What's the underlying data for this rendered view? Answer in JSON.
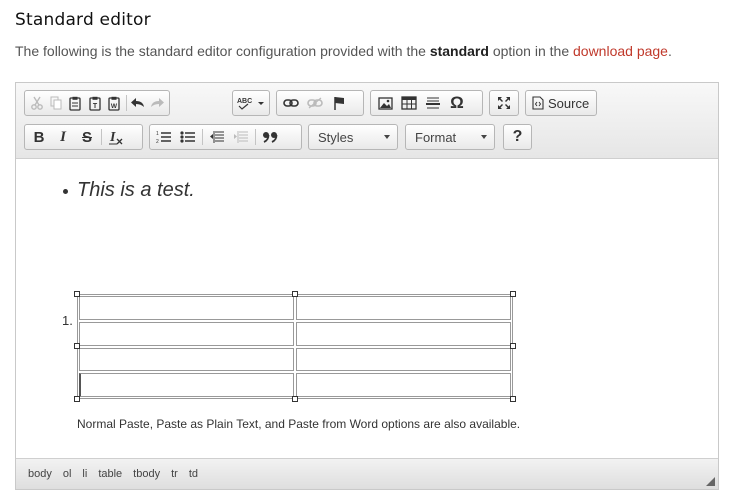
{
  "header": {
    "title": "Standard editor",
    "intro_prefix": "The following is the standard editor configuration provided with the ",
    "intro_bold": "standard",
    "intro_mid": " option in the ",
    "intro_link": "download page",
    "intro_end": "."
  },
  "toolbar": {
    "source_label": "Source",
    "styles_label": "Styles",
    "format_label": "Format",
    "help_label": "?",
    "spell_label": "ABC",
    "special_char": "Ω",
    "bold_glyph": "B",
    "italic_glyph": "I",
    "strike_glyph": "S",
    "remove_format_glyph": "Ix",
    "quote_glyph": "99"
  },
  "content": {
    "bullet_text": "This is a test.",
    "list_number": "1.",
    "note_text": "Normal Paste, Paste as Plain Text, and Paste from Word options are also available."
  },
  "statusbar": {
    "path": [
      "body",
      "ol",
      "li",
      "table",
      "tbody",
      "tr",
      "td"
    ]
  },
  "colors": {
    "link": "#c0392b",
    "toolbar_bg": "#e6e6e6"
  }
}
